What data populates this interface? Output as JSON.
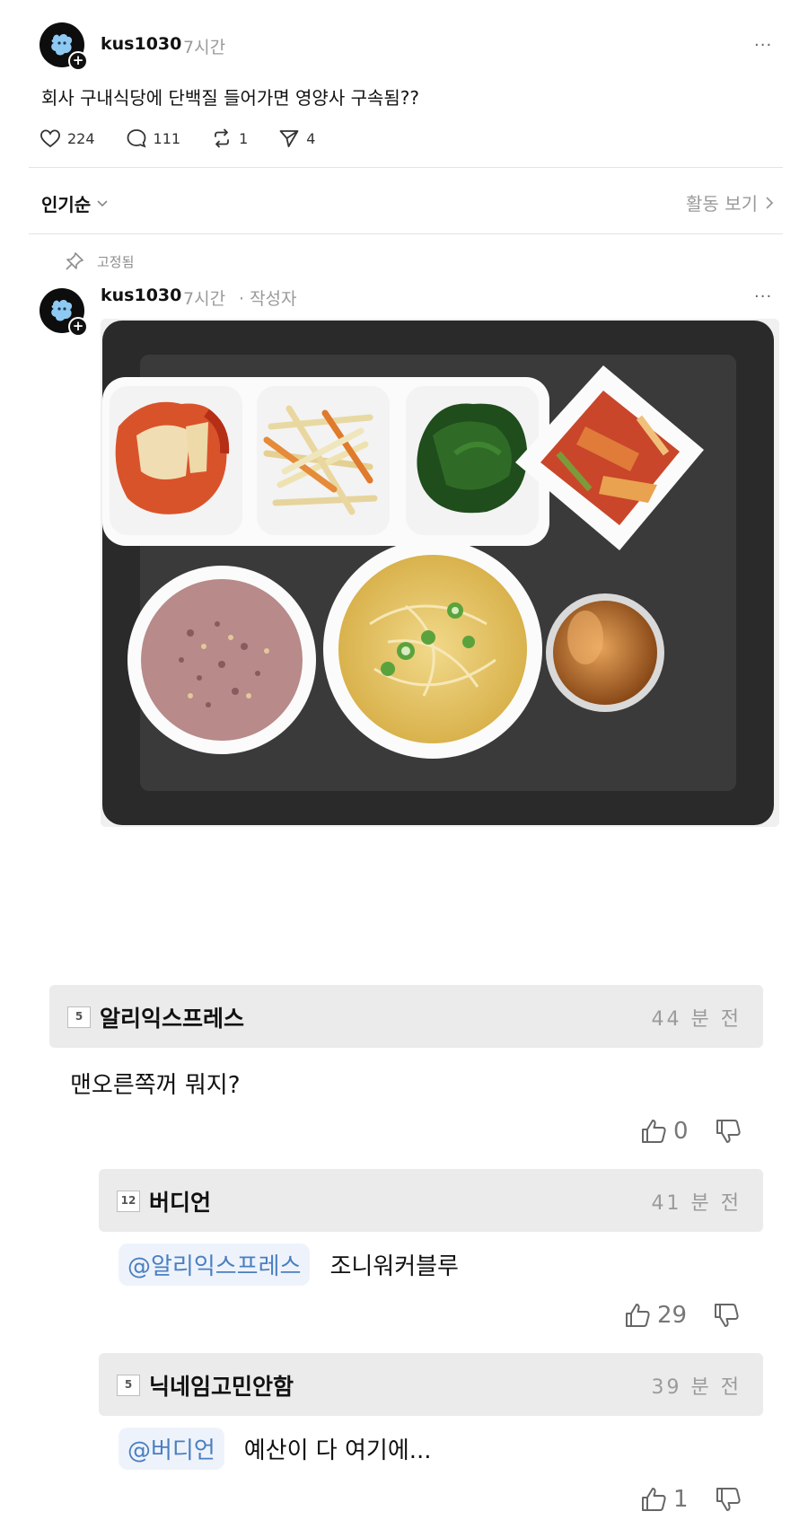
{
  "post": {
    "username": "kus1030",
    "time": "7시간",
    "more": "···",
    "text": "회사 구내식당에 단백질 들어가면 영양사 구속됨??",
    "stats": {
      "likes": "224",
      "comments": "111",
      "reposts": "1",
      "shares": "4"
    }
  },
  "sort": {
    "label": "인기순",
    "activity_label": "활동 보기"
  },
  "reply": {
    "pinned_label": "고정됨",
    "username": "kus1030",
    "time": "7시간",
    "author_tag": "· 작성자",
    "more": "···"
  },
  "comments": [
    {
      "level": "5",
      "name": "알리익스프레스",
      "time": "44 분 전",
      "text": "맨오른쪽꺼 뭐지?",
      "up": "0"
    },
    {
      "level": "12",
      "name": "버디언",
      "time": "41 분 전",
      "mention": "@알리익스프레스",
      "text": "조니워커블루",
      "up": "29"
    },
    {
      "level": "5",
      "name": "닉네임고민안함",
      "time": "39 분 전",
      "mention": "@버디언",
      "text": "예산이 다 여기에...",
      "up": "1"
    }
  ],
  "colors": {
    "comment_header_bg": "#ebebeb",
    "mention_text": "#4a7fc0",
    "mention_bg": "#eef3fb",
    "muted_text": "#9a9a9a"
  }
}
